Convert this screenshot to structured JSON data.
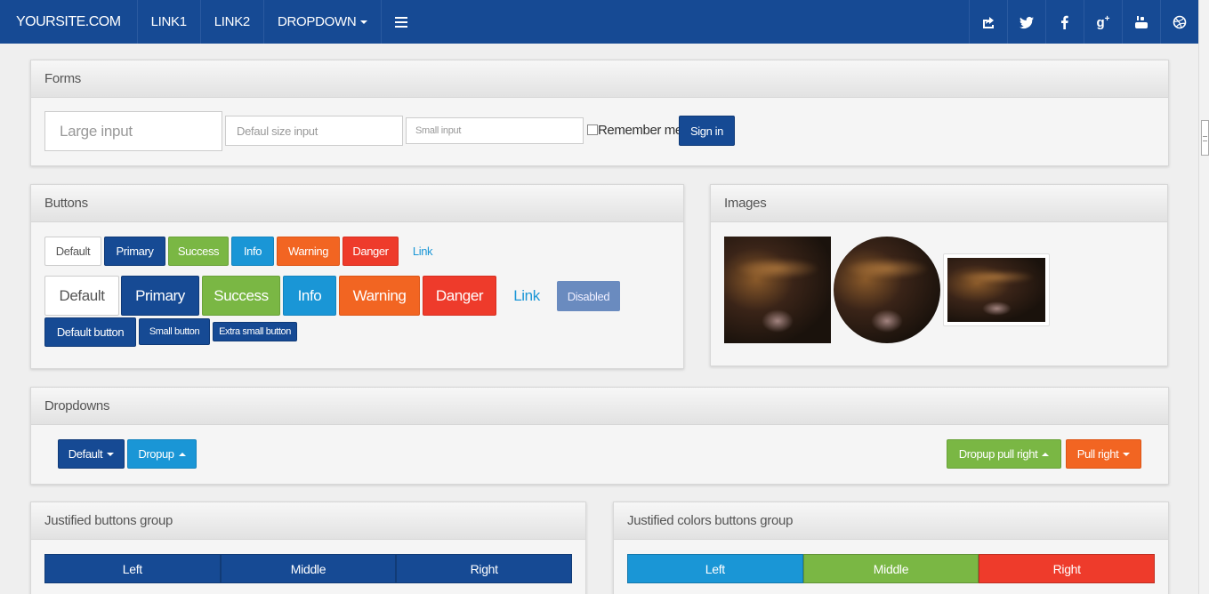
{
  "navbar": {
    "brand": "YOURSITE.COM",
    "links": [
      "LINK1",
      "LINK2"
    ],
    "dropdown": "DROPDOWN",
    "menu_icon": "hamburger-icon",
    "social_icons": [
      "share-icon",
      "twitter-icon",
      "facebook-icon",
      "google-plus-icon",
      "youtube-icon",
      "dribbble-icon"
    ]
  },
  "forms": {
    "title": "Forms",
    "large_placeholder": "Large input",
    "default_placeholder": "Defaul size input",
    "small_placeholder": "Small input",
    "remember_label": "Remember me",
    "signin_label": "Sign in"
  },
  "buttons": {
    "title": "Buttons",
    "row1": [
      "Default",
      "Primary",
      "Success",
      "Info",
      "Warning",
      "Danger",
      "Link"
    ],
    "row2": [
      "Default",
      "Primary",
      "Success",
      "Info",
      "Warning",
      "Danger",
      "Link",
      "Disabled"
    ],
    "row3": [
      "Default button",
      "Small button",
      "Extra small button"
    ]
  },
  "images": {
    "title": "Images"
  },
  "dropdowns": {
    "title": "Dropdowns",
    "default_label": "Default",
    "dropup_label": "Dropup",
    "dropup_right_label": "Dropup pull right",
    "pull_right_label": "Pull right"
  },
  "justified": {
    "title": "Justified buttons group",
    "buttons": [
      "Left",
      "Middle",
      "Right"
    ]
  },
  "justified_colors": {
    "title": "Justified colors buttons group",
    "buttons": [
      "Left",
      "Middle",
      "Right"
    ]
  },
  "colors": {
    "navbar": "#164a94",
    "primary": "#164a94",
    "success": "#7ab744",
    "info": "#1a96d6",
    "warning": "#f26522",
    "danger": "#ee3b2b"
  }
}
